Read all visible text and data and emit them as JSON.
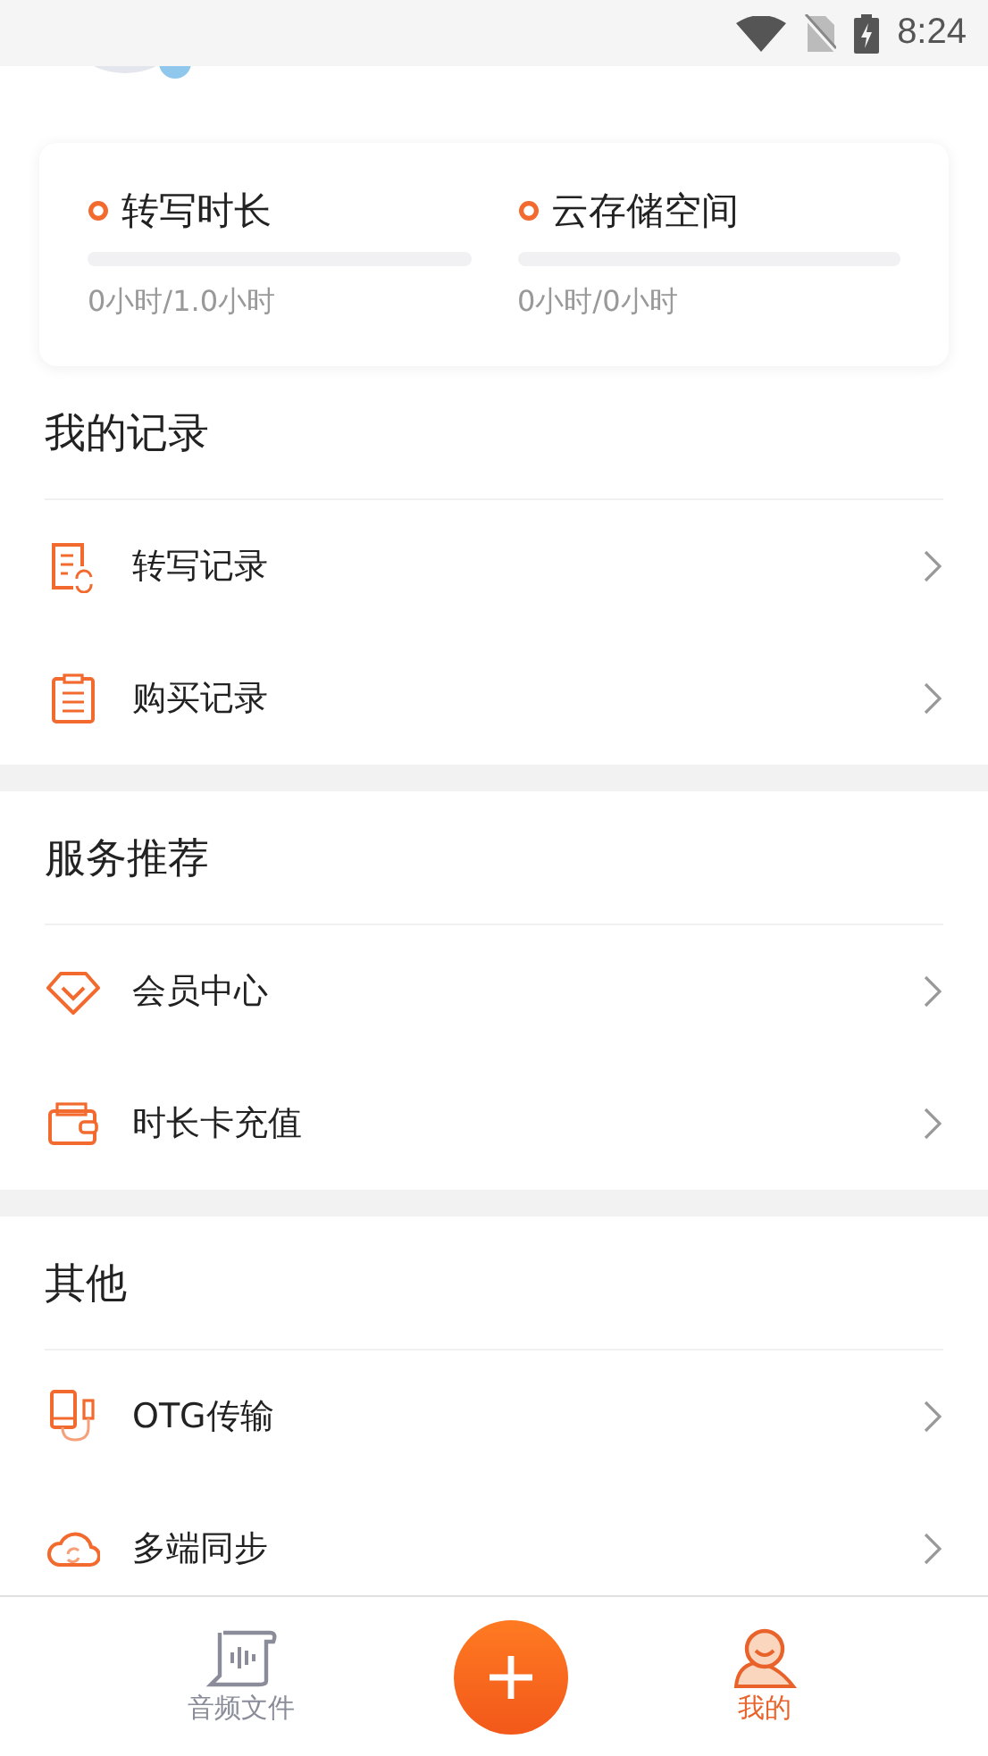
{
  "status_bar": {
    "time": "8:24"
  },
  "quota": [
    {
      "label": "转写时长",
      "level": 0,
      "reading": "0小时/1.0小时"
    },
    {
      "label": "云存储空间",
      "level": 0,
      "reading": "0小时/0小时"
    }
  ],
  "sections": [
    {
      "title": "我的记录",
      "items": [
        {
          "label": "转写记录",
          "kind": "transcript"
        },
        {
          "label": "购买记录",
          "kind": "clipboard"
        }
      ]
    },
    {
      "title": "服务推荐",
      "items": [
        {
          "label": "会员中心",
          "kind": "diamond"
        },
        {
          "label": "时长卡充值",
          "kind": "wallet"
        }
      ]
    },
    {
      "title": "其他",
      "items": [
        {
          "label": "OTG传输",
          "kind": "otg"
        },
        {
          "label": "多端同步",
          "kind": "cloud"
        }
      ]
    }
  ],
  "nav": [
    {
      "label": "音频文件",
      "kind": "files",
      "selected": false
    },
    {
      "kind": "add"
    },
    {
      "label": "我的",
      "kind": "profile",
      "selected": true
    }
  ]
}
